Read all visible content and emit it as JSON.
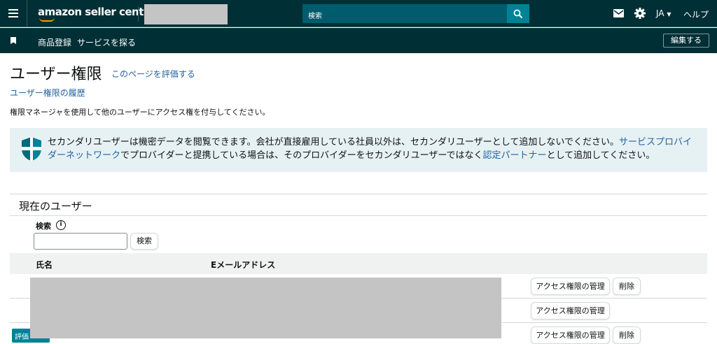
{
  "header": {
    "logo": "amazon seller central",
    "search_placeholder": "検索",
    "lang": "JA",
    "help": "ヘルプ"
  },
  "subnav": {
    "items": [
      "商品登録",
      "サービスを探る"
    ],
    "edit": "編集する"
  },
  "page": {
    "title": "ユーザー権限",
    "rate_link": "このページを評価する",
    "history_link": "ユーザー権限の履歴",
    "description": "権限マネージャを使用して他のユーザーにアクセス権を付与してください。"
  },
  "notice": {
    "text1": "セカンダリユーザーは機密データを閲覧できます。会社が直接雇用している社員以外は、セカンダリユーザーとして追加しないでください。",
    "link1": "サービスプロバイダーネットワーク",
    "text2": "でプロバイダーと提携している場合は、そのプロバイダーをセカンダリユーザーではなく",
    "link2": "認定パートナー",
    "text3": "として追加してください。"
  },
  "users": {
    "section_title": "現在のユーザー",
    "search_label": "検索",
    "search_button": "検索",
    "columns": [
      "氏名",
      "Eメールアドレス"
    ],
    "rows": [
      {
        "manage": "アクセス権限の管理",
        "delete": "削除"
      },
      {
        "manage": "アクセス権限の管理"
      },
      {
        "manage": "アクセス権限の管理",
        "delete": "削除"
      }
    ]
  },
  "feedback_button": "評価"
}
